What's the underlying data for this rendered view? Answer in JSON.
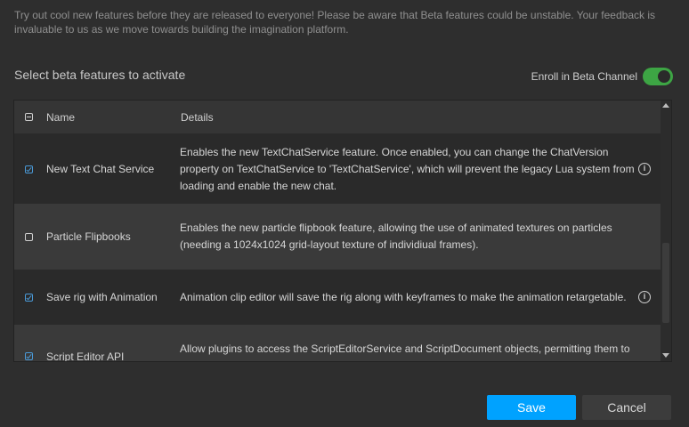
{
  "intro_text": "Try out cool new features before they are released to everyone! Please be aware that Beta features could be unstable. Your feedback is invaluable to us as we move towards building the imagination platform.",
  "section_title": "Select beta features to activate",
  "enroll": {
    "label": "Enroll in Beta Channel",
    "enabled": true,
    "accent_color": "#3da544"
  },
  "table": {
    "headers": {
      "name": "Name",
      "details": "Details"
    },
    "rows": [
      {
        "name": "New Text Chat Service",
        "details": "Enables the new TextChatService feature. Once enabled, you can change the ChatVersion property on TextChatService to 'TextChatService', which will prevent the legacy Lua system from loading and enable the new chat.",
        "checked": true,
        "info_icon": true
      },
      {
        "name": "Particle Flipbooks",
        "details": "Enables the new particle flipbook feature, allowing the use of animated textures on particles (needing a 1024x1024 grid-layout texture of individiual frames).",
        "checked": false,
        "info_icon": false
      },
      {
        "name": "Save rig with Animation",
        "details": "Animation clip editor will save the rig along with keyframes to make the animation retargetable.",
        "checked": true,
        "info_icon": true
      },
      {
        "name": "Script Editor API",
        "details": "Allow plugins to access the ScriptEditorService and ScriptDocument objects, permitting them to interact",
        "checked": true,
        "info_icon": false
      }
    ]
  },
  "buttons": {
    "save": "Save",
    "cancel": "Cancel"
  },
  "colors": {
    "save_button": "#00a2ff",
    "background": "#2e2e2e"
  },
  "icons": {
    "info": "info-icon",
    "checkbox": "checkbox-icon"
  }
}
